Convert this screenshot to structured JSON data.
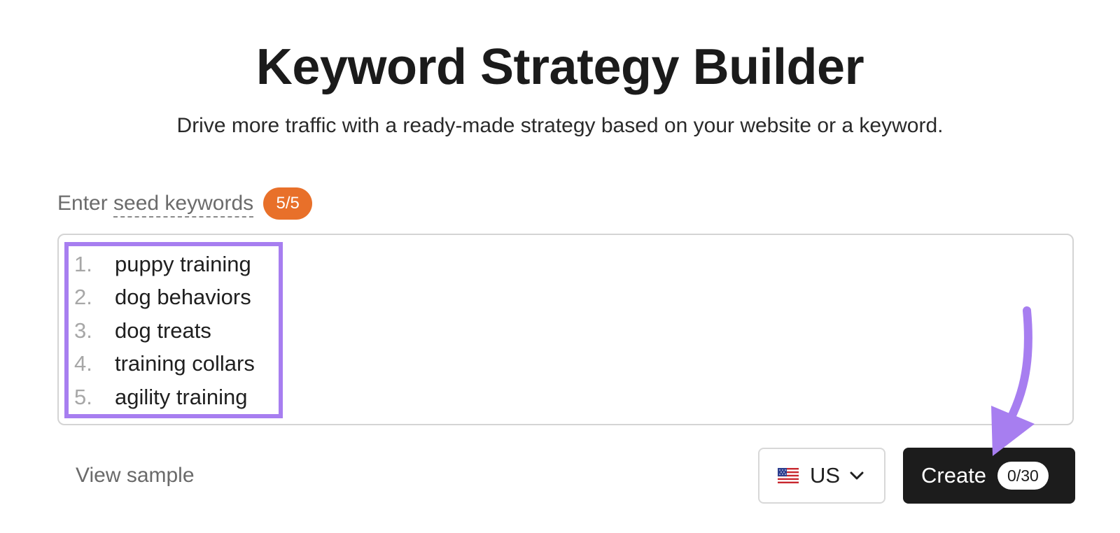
{
  "header": {
    "title": "Keyword Strategy Builder",
    "subtitle": "Drive more traffic with a ready-made strategy based on your website or a keyword."
  },
  "seed": {
    "label_prefix": "Enter ",
    "label_link": "seed keywords",
    "count_badge": "5/5",
    "keywords": [
      {
        "number": "1.",
        "text": "puppy training"
      },
      {
        "number": "2.",
        "text": "dog behaviors"
      },
      {
        "number": "3.",
        "text": "dog treats"
      },
      {
        "number": "4.",
        "text": "training collars"
      },
      {
        "number": "5.",
        "text": "agility training"
      }
    ]
  },
  "footer": {
    "view_sample": "View sample",
    "country": {
      "selected": "US",
      "flag_icon": "us-flag-icon"
    },
    "create": {
      "label": "Create",
      "count": "0/30"
    }
  },
  "colors": {
    "badge_orange": "#e8702a",
    "highlight_purple": "#a77ef0",
    "create_bg": "#1c1c1c"
  }
}
